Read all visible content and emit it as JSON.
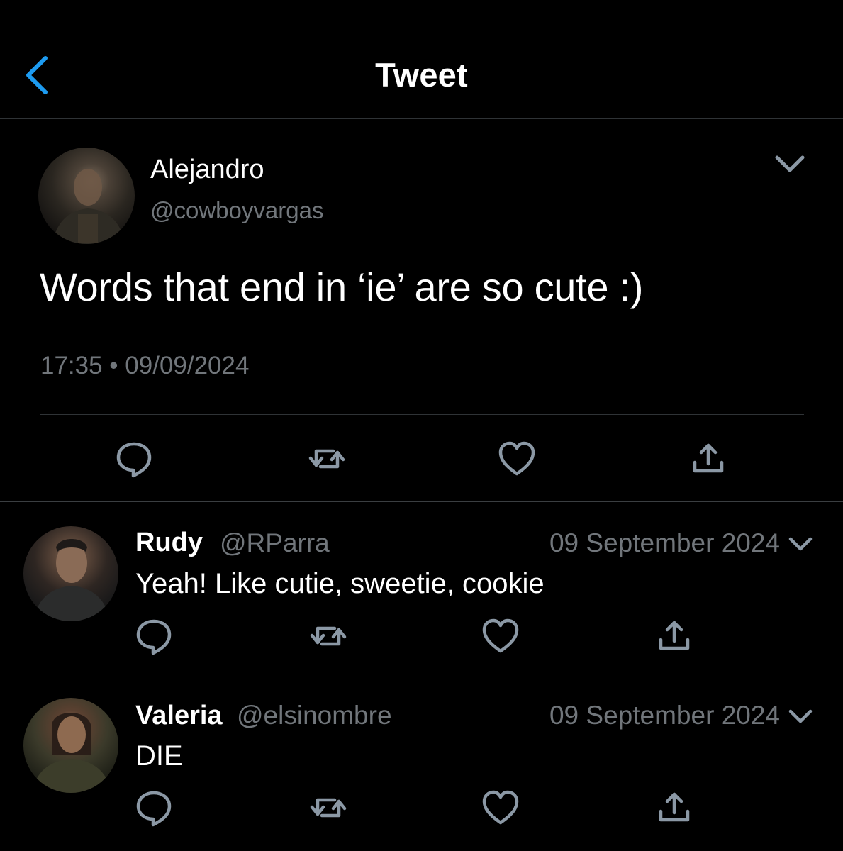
{
  "header": {
    "title": "Tweet",
    "accent_color": "#1d9bf0"
  },
  "main_tweet": {
    "author_name": "Alejandro",
    "author_handle": "@cowboyvargas",
    "text": "Words that end in ‘ie’ are so cute :)",
    "timestamp": "17:35 • 09/09/2024",
    "actions": [
      "reply-icon",
      "retweet-icon",
      "like-icon",
      "share-icon"
    ]
  },
  "replies": [
    {
      "name": "Rudy",
      "handle": "@RParra",
      "date": "09 September 2024",
      "text": "Yeah! Like cutie, sweetie, cookie"
    },
    {
      "name": "Valeria",
      "handle": "@elsinombre",
      "date": "09 September 2024",
      "text": "DIE"
    }
  ],
  "colors": {
    "background": "#000000",
    "primary_text": "#ffffff",
    "secondary_text": "#71767b",
    "divider": "#2f3336"
  }
}
